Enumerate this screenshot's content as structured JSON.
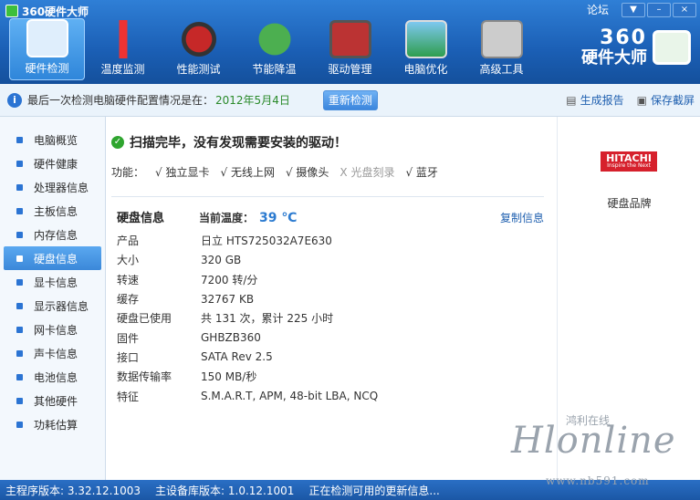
{
  "window": {
    "title": "360硬件大师",
    "links": [
      "论坛"
    ],
    "buttons": [
      "▼",
      "–",
      "×"
    ]
  },
  "toolbar": {
    "items": [
      {
        "label": "硬件检测",
        "icon": "monitor-magnifier-icon",
        "active": true
      },
      {
        "label": "温度监测",
        "icon": "thermometer-icon",
        "active": false
      },
      {
        "label": "性能测试",
        "icon": "speedometer-icon",
        "active": false
      },
      {
        "label": "节能降温",
        "icon": "clover-icon",
        "active": false
      },
      {
        "label": "驱动管理",
        "icon": "gear-chip-icon",
        "active": false
      },
      {
        "label": "电脑优化",
        "icon": "monitor-optimize-icon",
        "active": false
      },
      {
        "label": "高级工具",
        "icon": "toolbox-icon",
        "active": false
      }
    ],
    "brand": {
      "line1": "360",
      "line2": "硬件大师"
    }
  },
  "infobar": {
    "message": "最后一次检测电脑硬件配置情况是在：",
    "date": "2012年5月4日",
    "recheck": "重新检测",
    "report": "生成报告",
    "screenshot": "保存截屏"
  },
  "sidebar": {
    "items": [
      {
        "label": "电脑概览"
      },
      {
        "label": "硬件健康"
      },
      {
        "label": "处理器信息"
      },
      {
        "label": "主板信息"
      },
      {
        "label": "内存信息"
      },
      {
        "label": "硬盘信息"
      },
      {
        "label": "显卡信息"
      },
      {
        "label": "显示器信息"
      },
      {
        "label": "网卡信息"
      },
      {
        "label": "声卡信息"
      },
      {
        "label": "电池信息"
      },
      {
        "label": "其他硬件"
      },
      {
        "label": "功耗估算"
      }
    ],
    "active_index": 5
  },
  "main": {
    "scan_msg": "扫描完毕，没有发现需要安装的驱动！",
    "features_label": "功能：",
    "features": [
      {
        "label": "√ 独立显卡",
        "on": true
      },
      {
        "label": "√ 无线上网",
        "on": true
      },
      {
        "label": "√ 摄像头",
        "on": true
      },
      {
        "label": "X 光盘刻录",
        "on": false
      },
      {
        "label": "√ 蓝牙",
        "on": true
      }
    ],
    "disk_title": "硬盘信息",
    "temp_label": "当前温度：",
    "temp_value": "39 ℃",
    "copy": "复制信息",
    "rows": [
      {
        "k": "产品",
        "v": "日立 HTS725032A7E630"
      },
      {
        "k": "大小",
        "v": "320 GB"
      },
      {
        "k": "转速",
        "v": "7200 转/分"
      },
      {
        "k": "缓存",
        "v": "32767 KB"
      },
      {
        "k": "硬盘已使用",
        "v": "共 131 次，累计 225 小时"
      },
      {
        "k": "固件",
        "v": "GHBZB360"
      },
      {
        "k": "接口",
        "v": "SATA Rev 2.5"
      },
      {
        "k": "数据传输率",
        "v": "150 MB/秒"
      },
      {
        "k": "特征",
        "v": "S.M.A.R.T,  APM,  48-bit LBA,  NCQ"
      }
    ]
  },
  "right": {
    "logo_line1": "HITACHI",
    "logo_line2": "Inspire the Next",
    "brand_label": "硬盘品牌"
  },
  "status": {
    "main_ver": "主程序版本: 3.32.12.1003",
    "db_ver": "主设备库版本: 1.0.12.1001",
    "update": "正在检测可用的更新信息..."
  },
  "watermark": {
    "name": "Hlonline",
    "cn": "鸿利在线",
    "url": "www.nb591.com"
  }
}
